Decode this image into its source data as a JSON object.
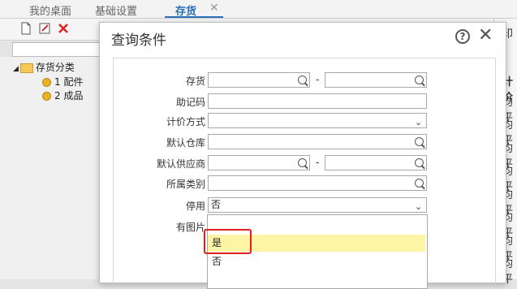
{
  "tabs": [
    {
      "label": "我的桌面"
    },
    {
      "label": "基础设置"
    },
    {
      "label": "存货",
      "active": true
    }
  ],
  "tree": {
    "root": "存货分类",
    "items": [
      {
        "label": "1 配件"
      },
      {
        "label": "2 成品"
      }
    ]
  },
  "right_col": [
    "印",
    "计价",
    "均平",
    "均平",
    "均平",
    "均平",
    "均平",
    "均平",
    "均平",
    "均平"
  ],
  "dialog": {
    "title": "查询条件",
    "fields": {
      "stock": {
        "label": "存货",
        "range_sep": "-"
      },
      "mnemonic": {
        "label": "助记码"
      },
      "valuation": {
        "label": "计价方式"
      },
      "warehouse": {
        "label": "默认仓库"
      },
      "supplier": {
        "label": "默认供应商",
        "range_sep": "-"
      },
      "category": {
        "label": "所属类别"
      },
      "disabled": {
        "label": "停用",
        "value": "否"
      },
      "has_image": {
        "label": "有图片"
      }
    },
    "dropdown_options": [
      {
        "label": "是",
        "highlighted": true
      },
      {
        "label": "否"
      }
    ]
  },
  "colors": {
    "accent": "#2a6fb8",
    "highlight": "#fdf4a6",
    "annotation": "#e02020"
  }
}
